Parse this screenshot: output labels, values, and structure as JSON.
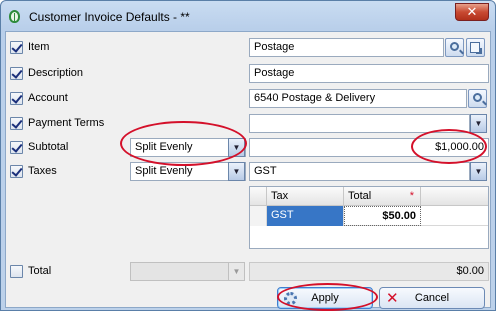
{
  "window": {
    "title": "Customer Invoice Defaults - **",
    "close_label": "✕"
  },
  "fields": {
    "item": {
      "label": "Item",
      "checked": true,
      "value": "Postage"
    },
    "description": {
      "label": "Description",
      "checked": true,
      "value": "Postage"
    },
    "account": {
      "label": "Account",
      "checked": true,
      "value": "6540  Postage & Delivery"
    },
    "payment_terms": {
      "label": "Payment Terms",
      "checked": true,
      "value": ""
    },
    "subtotal": {
      "label": "Subtotal",
      "checked": true,
      "method": "Split Evenly",
      "value": "$1,000.00"
    },
    "taxes": {
      "label": "Taxes",
      "checked": true,
      "method": "Split Evenly",
      "value": "GST"
    },
    "total": {
      "label": "Total",
      "checked": false,
      "method": "",
      "value": "$0.00"
    }
  },
  "tax_grid": {
    "columns": [
      "Tax",
      "Total"
    ],
    "required_marker": "*",
    "rows": [
      {
        "tax": "GST",
        "total": "$50.00"
      }
    ]
  },
  "buttons": {
    "apply_label": "Apply",
    "cancel_label": "Cancel"
  },
  "icons": {
    "lookup": "search-icon",
    "browse": "browse-icon",
    "dropdown": "chevron-down-icon",
    "apply": "gear-icon",
    "cancel": "x-icon"
  },
  "colors": {
    "title_bg": "#c4d8ef",
    "selection": "#3776c6",
    "annotation": "#d4102a",
    "close": "#c84a32"
  }
}
